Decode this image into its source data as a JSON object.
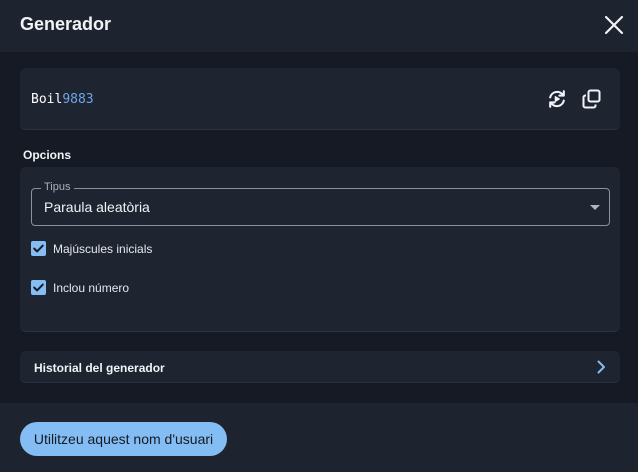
{
  "header": {
    "title": "Generador"
  },
  "generated": {
    "prefix": "Boil",
    "digits": "9883"
  },
  "options": {
    "label": "Opcions",
    "type_select": {
      "legend": "Tipus",
      "value": "Paraula aleatòria"
    },
    "checkboxes": [
      {
        "label": "Majúscules inicials",
        "checked": true
      },
      {
        "label": "Inclou número",
        "checked": true
      }
    ]
  },
  "history": {
    "label": "Historial del generador"
  },
  "footer": {
    "primary_label": "Utilitzeu aquest nom d'usuari"
  },
  "colors": {
    "accent": "#84bdf3",
    "digits": "#6ca6e8",
    "background": "#151a24"
  },
  "icons": [
    "close-icon",
    "regenerate-icon",
    "copy-icon",
    "chevron-right-icon",
    "checkmark-icon"
  ]
}
